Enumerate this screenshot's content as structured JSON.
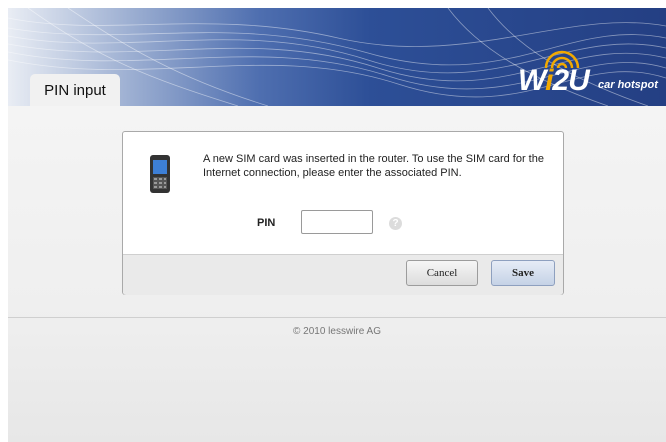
{
  "header": {
    "tab_label": "PIN input",
    "logo_text": "Wi2U",
    "logo_subtext": "car hotspot"
  },
  "dialog": {
    "message": "A new SIM card was inserted in the router. To use the SIM card for the Internet connection, please enter the associated PIN.",
    "pin_label": "PIN",
    "pin_value": "",
    "pin_placeholder": "",
    "help_icon": "help-icon",
    "cancel_label": "Cancel",
    "save_label": "Save"
  },
  "footer": {
    "copyright": "© 2010 lesswire AG"
  },
  "colors": {
    "header_blue": "#243f83",
    "logo_accent": "#f2a900"
  }
}
